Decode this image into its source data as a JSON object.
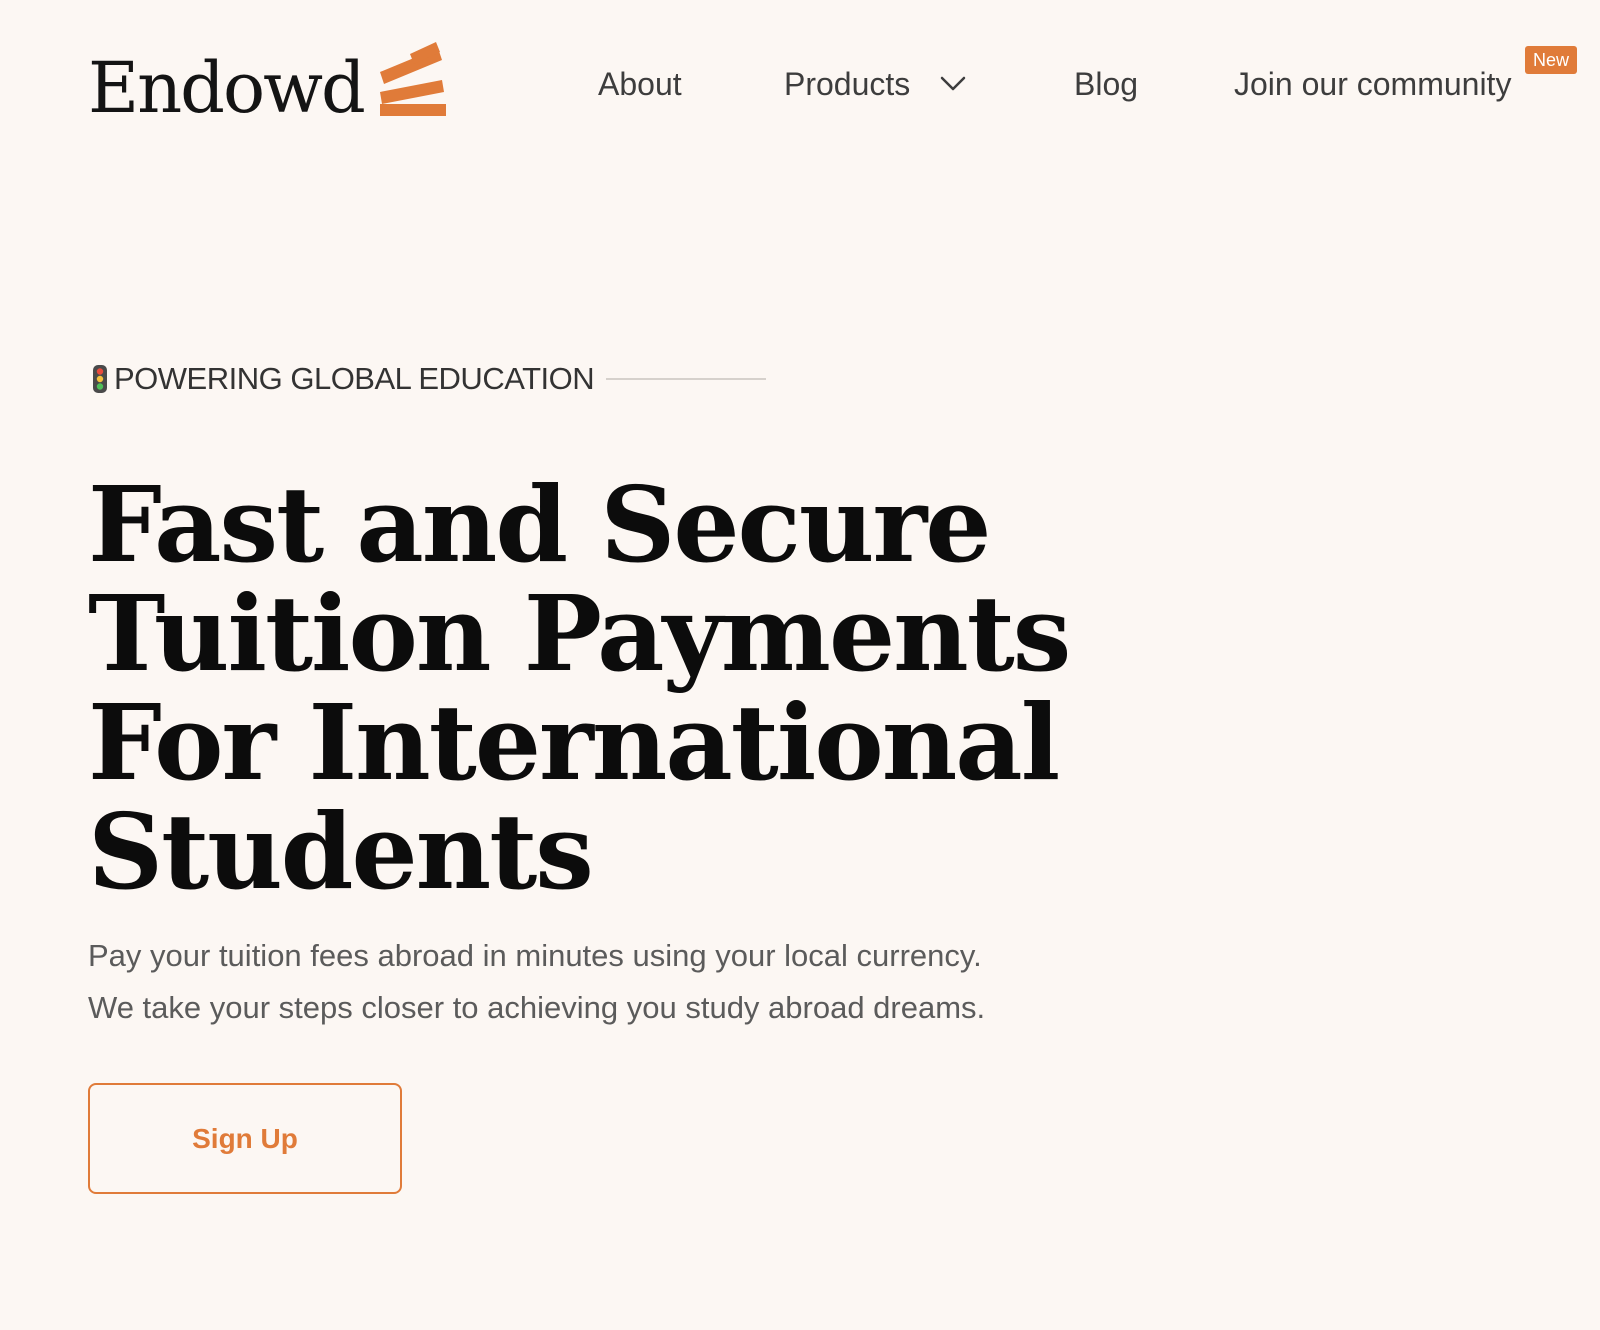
{
  "brand": {
    "name": "Endowd",
    "logo_icon": "stacked-bars-logo",
    "accent_color": "#e07b39"
  },
  "nav": {
    "about": "About",
    "products": "Products",
    "products_icon": "chevron-down-icon",
    "blog": "Blog",
    "community": "Join our community",
    "community_badge": "New"
  },
  "hero": {
    "eyebrow_icon": "traffic-light-icon",
    "eyebrow": "POWERING GLOBAL EDUCATION",
    "headline_lines": [
      "Fast and Secure",
      "Tuition Payments",
      "For International",
      "Students"
    ],
    "subtext_lines": [
      "Pay your tuition fees abroad in minutes using your local currency.",
      "We take your steps closer to achieving you study abroad dreams."
    ],
    "cta_label": "Sign Up"
  }
}
